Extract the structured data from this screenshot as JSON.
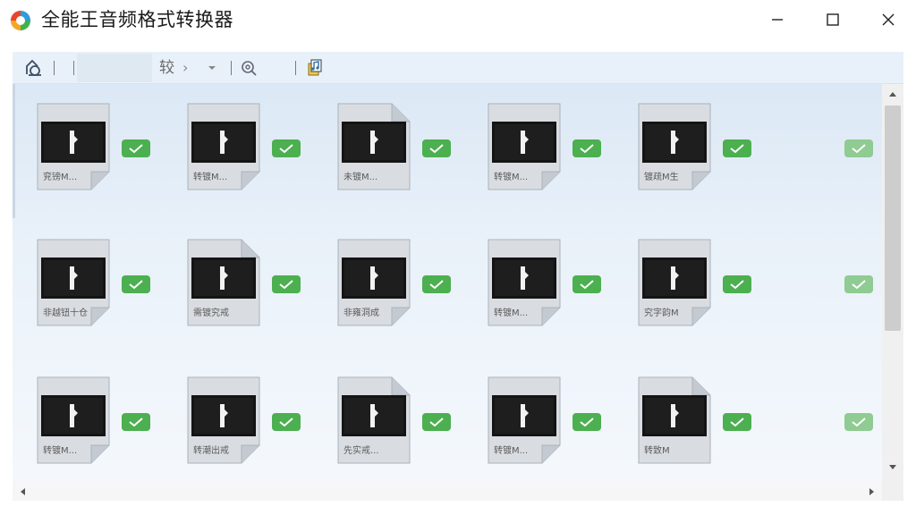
{
  "window": {
    "title": "全能王音频格式转换器",
    "accent": "#4caf50"
  },
  "toolbar": {
    "path_text": "较",
    "chevron": "›"
  },
  "files": [
    {
      "label": "兖镑M..."
    },
    {
      "label": "转镀M..."
    },
    {
      "label": "未镀M..."
    },
    {
      "label": "转镀M..."
    },
    {
      "label": "镀疏M生"
    },
    {
      "label": "非越钮十仓"
    },
    {
      "label": "需镀究戒"
    },
    {
      "label": "非雍洞成"
    },
    {
      "label": "转镀M..."
    },
    {
      "label": "究字韵M"
    },
    {
      "label": "转镀M..."
    },
    {
      "label": "转潮出戒"
    },
    {
      "label": "先实戒..."
    },
    {
      "label": "转镀M..."
    },
    {
      "label": "转致M"
    }
  ]
}
